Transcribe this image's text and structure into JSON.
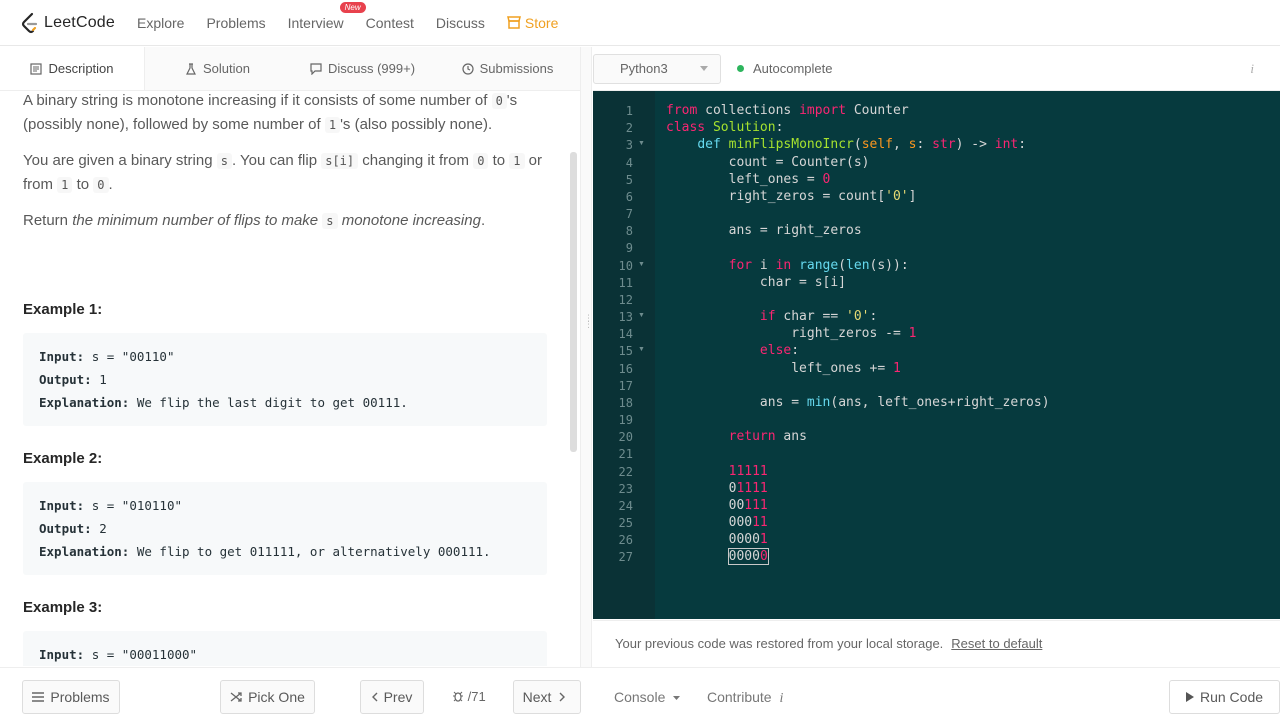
{
  "nav": {
    "brand": "LeetCode",
    "links": [
      "Explore",
      "Problems",
      "Interview",
      "Contest",
      "Discuss"
    ],
    "new_badge": "New",
    "store": "Store",
    "store_color": "#f0a020"
  },
  "tabs": [
    {
      "label": "Description",
      "icon": "document-icon"
    },
    {
      "label": "Solution",
      "icon": "flask-icon"
    },
    {
      "label": "Discuss (999+)",
      "icon": "comment-icon"
    },
    {
      "label": "Submissions",
      "icon": "clock-icon"
    }
  ],
  "description": {
    "p1": {
      "a": "A binary string is monotone increasing if it consists of some number of ",
      "c1": "0",
      "b": "'s (possibly none), followed by some number of ",
      "c2": "1",
      "d": "'s (also possibly none)."
    },
    "p2": {
      "a": "You are given a binary string ",
      "c1": "s",
      "b": ". You can flip ",
      "c2": "s[i]",
      "c": " changing it from ",
      "c3": "0",
      "d": " to ",
      "c4": "1",
      "e": " or from ",
      "c5": "1",
      "f": " to ",
      "c6": "0",
      "g": "."
    },
    "p3": {
      "a": "Return ",
      "em1": "the minimum number of flips to make ",
      "c1": "s",
      "em2": " monotone increasing",
      "b": "."
    }
  },
  "examples": [
    {
      "title": "Example 1:",
      "input": "s = \"00110\"",
      "output": "1",
      "explanation": "We flip the last digit to get 00111."
    },
    {
      "title": "Example 2:",
      "input": "s = \"010110\"",
      "output": "2",
      "explanation": "We flip to get 011111, or alternatively 000111."
    },
    {
      "title": "Example 3:",
      "input": "s = \"00011000\""
    }
  ],
  "labels": {
    "input": "Input:",
    "output": "Output:",
    "explanation": "Explanation:"
  },
  "editor": {
    "language": "Python3",
    "autocomplete": "Autocomplete",
    "info": "i",
    "line_numbers": [
      "1",
      "2",
      "3",
      "4",
      "5",
      "6",
      "7",
      "8",
      "9",
      "10",
      "11",
      "12",
      "13",
      "14",
      "15",
      "16",
      "17",
      "18",
      "19",
      "20",
      "21",
      "22",
      "23",
      "24",
      "25",
      "26",
      "27"
    ],
    "restore_msg": "Your previous code was restored from your local storage.",
    "reset_link": "Reset to default",
    "theme_bg": "#063a3e"
  },
  "bottom": {
    "problems": "Problems",
    "pick_one": "Pick One",
    "prev": "Prev",
    "page": "/71",
    "next": "Next",
    "console": "Console",
    "contribute": "Contribute",
    "run_code": "Run Code"
  }
}
